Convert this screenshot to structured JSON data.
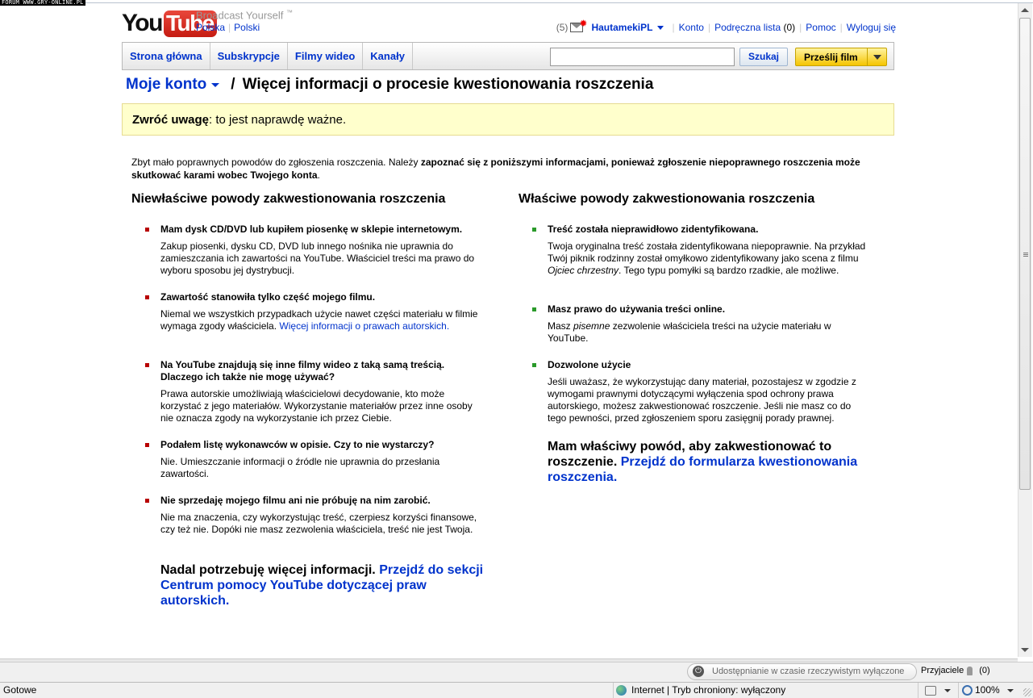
{
  "watermark": "FORUM WWW.GRY-ONLINE.PL",
  "header": {
    "logo_you": "You",
    "logo_tube": "Tube",
    "tagline": "Broadcast Yourself",
    "tm": "™",
    "locale_country": "Polska",
    "locale_language": "Polski"
  },
  "user": {
    "message_count": "(5)",
    "username": "HautamekiPL",
    "account": "Konto",
    "quicklist": "Podręczna lista",
    "quicklist_count": "(0)",
    "help": "Pomoc",
    "logout": "Wyloguj się"
  },
  "nav": {
    "tabs": [
      "Strona główna",
      "Subskrypcje",
      "Filmy wideo",
      "Kanały"
    ],
    "search_value": "",
    "search_button": "Szukaj",
    "upload_button": "Prześlij film"
  },
  "breadcrumb": {
    "my_account": "Moje konto",
    "separator": "/",
    "title": "Więcej informacji o procesie kwestionowania roszczenia"
  },
  "notice": {
    "bold": "Zwróć uwagę",
    "text": ": to jest naprawdę ważne."
  },
  "intro": {
    "text": "Zbyt mało poprawnych powodów do zgłoszenia roszczenia. Należy ",
    "bold": "zapoznać się z poniższymi informacjami, ponieważ zgłoszenie niepoprawnego roszczenia może skutkować karami wobec Twojego konta",
    "end": "."
  },
  "left": {
    "heading": "Niewłaściwe powody zakwestionowania roszczenia",
    "items": [
      {
        "head": "Mam dysk CD/DVD lub kupiłem piosenkę w sklepie internetowym.",
        "body": "Zakup piosenki, dysku CD, DVD lub innego nośnika nie uprawnia do zamieszczania ich zawartości na YouTube. Właściciel treści ma prawo do wyboru sposobu jej dystrybucji."
      },
      {
        "head": "Zawartość stanowiła tylko część mojego filmu.",
        "body": "Niemal we wszystkich przypadkach użycie nawet części materiału w filmie wymaga zgody właściciela. ",
        "link": "Więcej informacji o prawach autorskich."
      },
      {
        "head": "Na YouTube znajdują się inne filmy wideo z taką samą treścią. Dlaczego ich także nie mogę używać?",
        "body": "Prawa autorskie umożliwiają właścicielowi decydowanie, kto może korzystać z jego materiałów. Wykorzystanie materiałów przez inne osoby nie oznacza zgody na wykorzystanie ich przez Ciebie."
      },
      {
        "head": "Podałem listę wykonawców w opisie. Czy to nie wystarczy?",
        "body": "Nie. Umieszczanie informacji o źródle nie uprawnia do przesłania zawartości."
      },
      {
        "head": "Nie sprzedaję mojego filmu ani nie próbuję na nim zarobić.",
        "body": "Nie ma znaczenia, czy wykorzystując treść, czerpiesz korzyści finansowe, czy też nie. Dopóki nie masz zezwolenia właściciela, treść nie jest Twoja."
      }
    ],
    "more_text": "Nadal potrzebuję więcej informacji. ",
    "more_link": "Przejdź do sekcji Centrum pomocy YouTube dotyczącej praw autorskich."
  },
  "right": {
    "heading": "Właściwe powody zakwestionowania roszczenia",
    "items": [
      {
        "head": "Treść została nieprawidłowo zidentyfikowana.",
        "body_a": "Twoja oryginalna treść została zidentyfikowana niepoprawnie. Na przykład Twój piknik rodzinny został omyłkowo zidentyfikowany jako scena z filmu ",
        "body_em": "Ojciec chrzestny",
        "body_b": ". Tego typu pomyłki są bardzo rzadkie, ale możliwe."
      },
      {
        "head": "Masz prawo do używania treści online.",
        "body_a": "Masz ",
        "body_em": "pisemne",
        "body_b": " zezwolenie właściciela treści na użycie materiału w YouTube."
      },
      {
        "head": "Dozwolone użycie",
        "body_a": "Jeśli uważasz, że wykorzystując dany materiał, pozostajesz w zgodzie z wymogami prawnymi dotyczącymi wyłączenia spod ochrony prawa autorskiego, możesz zakwestionować roszczenie. Jeśli nie masz co do tego pewności, przed zgłoszeniem sporu zasięgnij porady prawnej.",
        "body_em": "",
        "body_b": ""
      }
    ],
    "cta_text": "Mam właściwy powód, aby zakwestionować to roszczenie. ",
    "cta_link": "Przejdź do formularza kwestionowania roszczenia."
  },
  "browser": {
    "share_status": "Udostępnianie w czasie rzeczywistym wyłączone",
    "friends_label": "Przyjaciele",
    "friends_count": "(0)",
    "status_left": "Gotowe",
    "zone": "Internet | Tryb chroniony: wyłączony",
    "zoom": "100%"
  },
  "colors": {
    "link": "#0033cc",
    "notice_bg": "#ffffcc",
    "bullet_bad": "#b80000",
    "bullet_good": "#2a9a2a",
    "upload_yellow": "#f5c400"
  }
}
